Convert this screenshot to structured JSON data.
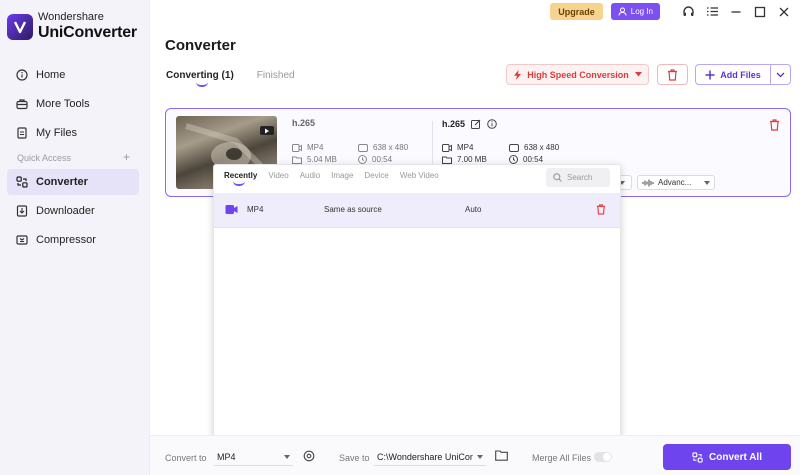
{
  "app": {
    "brand_top": "Wondershare",
    "brand_bottom": "UniConverter"
  },
  "titlebar": {
    "upgrade_label": "Upgrade",
    "login_label": "Log In"
  },
  "sidebar": {
    "items": [
      {
        "label": "Home"
      },
      {
        "label": "More Tools"
      },
      {
        "label": "My Files"
      },
      {
        "label": "Converter",
        "active": true
      },
      {
        "label": "Downloader"
      },
      {
        "label": "Compressor"
      }
    ],
    "quick_access_label": "Quick Access",
    "quick_access_add": "+"
  },
  "main": {
    "title": "Converter",
    "tabs": [
      {
        "label": "Converting (1)",
        "active": true
      },
      {
        "label": "Finished"
      }
    ],
    "high_speed_label": "High Speed Conversion",
    "add_files_label": "Add Files"
  },
  "file": {
    "source": {
      "name": "h.265",
      "format": "MP4",
      "resolution": "638 x 480",
      "size": "5.04 MB",
      "duration": "00:54"
    },
    "output": {
      "name": "h.265",
      "format": "MP4",
      "resolution": "638 x 480",
      "size": "7.00 MB",
      "duration": "00:54"
    },
    "advanced_label": "Advanc..."
  },
  "format_popup": {
    "tabs": [
      {
        "label": "Recently",
        "active": true
      },
      {
        "label": "Video"
      },
      {
        "label": "Audio"
      },
      {
        "label": "Image"
      },
      {
        "label": "Device"
      },
      {
        "label": "Web Video"
      }
    ],
    "search_placeholder": "Search",
    "rows": [
      {
        "format": "MP4",
        "quality": "Same as source",
        "encoder": "Auto"
      }
    ]
  },
  "bottom_bar": {
    "convert_to_label": "Convert to",
    "convert_to_value": "MP4",
    "save_to_label": "Save to",
    "save_to_value": "C:\\Wondershare UniCor",
    "merge_label": "Merge All Files",
    "convert_all_label": "Convert All"
  },
  "colors": {
    "accent": "#6d44ee",
    "danger": "#e23a3a",
    "upgrade": "#f6d48f"
  }
}
